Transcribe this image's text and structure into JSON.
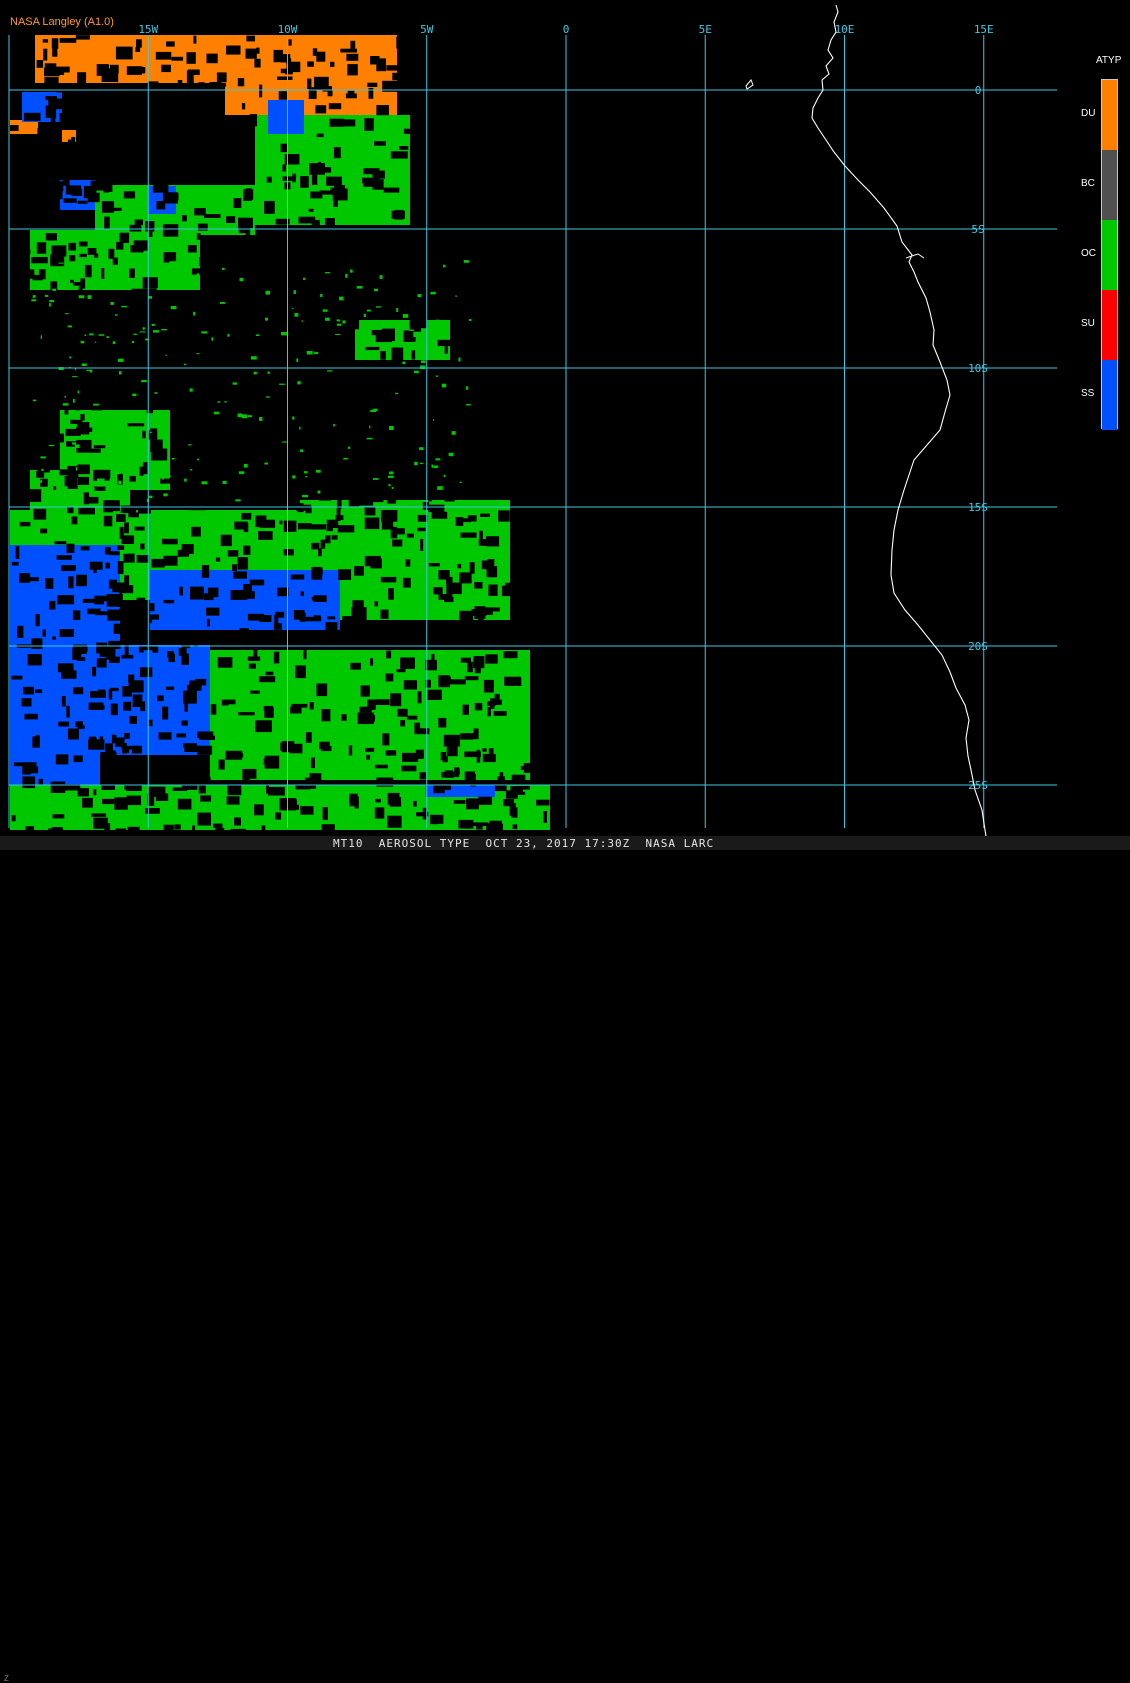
{
  "credit": "NASA Langley (A1.0)",
  "map": {
    "lon_range": [
      -20,
      15
    ],
    "lat_range": [
      -26,
      2
    ],
    "grid_color": "#3ec8e0",
    "coastline_color": "#ffffff",
    "lon_labels": [
      {
        "lon": -15,
        "label": "15W"
      },
      {
        "lon": -10,
        "label": "10W"
      },
      {
        "lon": -5,
        "label": "5W"
      },
      {
        "lon": 0,
        "label": "0"
      },
      {
        "lon": 5,
        "label": "5E"
      },
      {
        "lon": 10,
        "label": "10E"
      },
      {
        "lon": 15,
        "label": "15E"
      }
    ],
    "lat_labels": [
      {
        "lat": 0,
        "label": "0"
      },
      {
        "lat": -5,
        "label": "5S"
      },
      {
        "lat": -10,
        "label": "10S"
      },
      {
        "lat": -15,
        "label": "15S"
      },
      {
        "lat": -20,
        "label": "20S"
      },
      {
        "lat": -25,
        "label": "25S"
      }
    ]
  },
  "legend": {
    "title": "ATYP",
    "items": [
      {
        "code": "DU",
        "color": "#ff8000"
      },
      {
        "code": "BC",
        "color": "#505050"
      },
      {
        "code": "OC",
        "color": "#00c800"
      },
      {
        "code": "SU",
        "color": "#ff0000"
      },
      {
        "code": "SS",
        "color": "#0050ff"
      }
    ]
  },
  "footer": "MT10  AEROSOL TYPE  OCT 23, 2017 17:30Z  NASA LARC",
  "corner_mark": "Z"
}
